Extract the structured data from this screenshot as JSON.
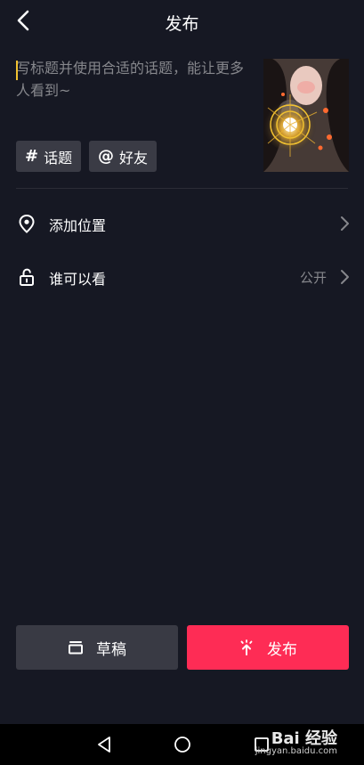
{
  "header": {
    "title": "发布",
    "back_icon": "chevron-left-icon"
  },
  "caption": {
    "placeholder": "写标题并使用合适的话题，能让更多人看到~",
    "value": ""
  },
  "chips": [
    {
      "symbol": "#",
      "label": "话题",
      "icon": "hashtag-icon"
    },
    {
      "symbol": "@",
      "label": "好友",
      "icon": "at-icon"
    }
  ],
  "rows": {
    "location": {
      "label": "添加位置",
      "icon": "location-pin-icon"
    },
    "privacy": {
      "label": "谁可以看",
      "value": "公开",
      "icon": "unlock-icon"
    }
  },
  "buttons": {
    "draft": {
      "label": "草稿",
      "icon": "draft-box-icon"
    },
    "publish": {
      "label": "发布",
      "icon": "publish-upload-icon"
    }
  },
  "colors": {
    "background": "#161823",
    "accent": "#fe2c55",
    "chip": "#3a3b45",
    "muted": "#86878c"
  },
  "watermark": {
    "brand": "Bai 经验",
    "url": "jingyan.baidu.com"
  }
}
